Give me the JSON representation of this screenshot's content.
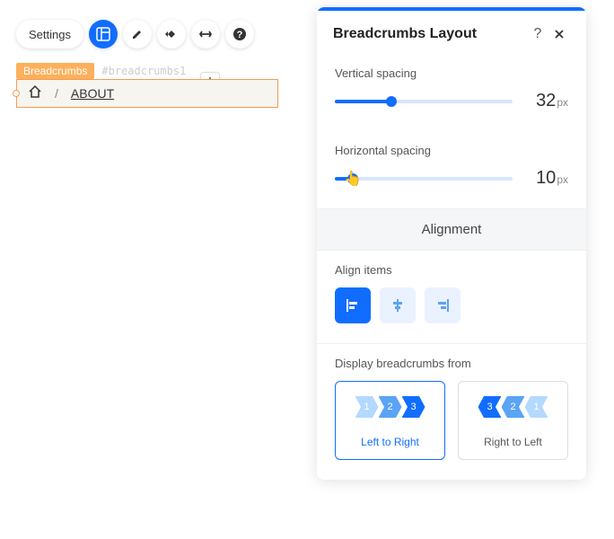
{
  "toolbar": {
    "settings_label": "Settings"
  },
  "tags": {
    "label": "Breadcrumbs",
    "id": "#breadcrumbs1"
  },
  "breadcrumb": {
    "separator": "/",
    "current": "ABOUT"
  },
  "panel": {
    "title": "Breadcrumbs Layout",
    "vertical": {
      "label": "Vertical spacing",
      "value": "32",
      "unit": "px",
      "percent": 32
    },
    "horizontal": {
      "label": "Horizontal spacing",
      "value": "10",
      "unit": "px",
      "percent": 10
    },
    "alignment_header": "Alignment",
    "align_label": "Align items",
    "display_label": "Display breadcrumbs from",
    "ltr": {
      "label": "Left to Right",
      "n1": "1",
      "n2": "2",
      "n3": "3"
    },
    "rtl": {
      "label": "Right to Left",
      "n1": "3",
      "n2": "2",
      "n3": "1"
    }
  }
}
